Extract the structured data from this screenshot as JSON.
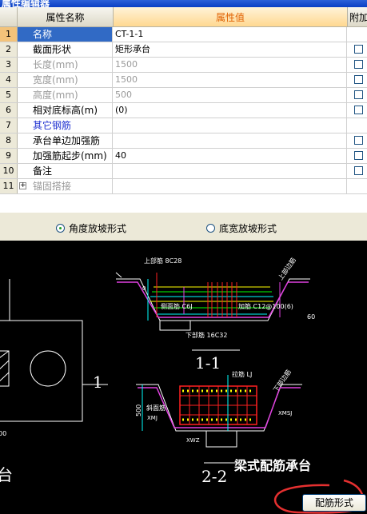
{
  "window": {
    "title": "属性编辑器"
  },
  "table": {
    "headers": {
      "num": "",
      "name": "属性名称",
      "value": "属性值",
      "extra": "附加"
    },
    "rows": [
      {
        "num": "1",
        "name": "名称",
        "value": "CT-1-1",
        "name_style": "normal",
        "value_style": "normal",
        "checkbox": false,
        "selected": true
      },
      {
        "num": "2",
        "name": "截面形状",
        "value": "矩形承台",
        "name_style": "normal",
        "value_style": "normal",
        "checkbox": true
      },
      {
        "num": "3",
        "name": "长度(mm)",
        "value": "1500",
        "name_style": "grey",
        "value_style": "grey",
        "checkbox": true
      },
      {
        "num": "4",
        "name": "宽度(mm)",
        "value": "1500",
        "name_style": "grey",
        "value_style": "grey",
        "checkbox": true
      },
      {
        "num": "5",
        "name": "高度(mm)",
        "value": "500",
        "name_style": "grey",
        "value_style": "grey",
        "checkbox": true
      },
      {
        "num": "6",
        "name": "相对底标高(m)",
        "value": "(0)",
        "name_style": "normal",
        "value_style": "normal",
        "checkbox": true
      },
      {
        "num": "7",
        "name": "其它钢筋",
        "value": "",
        "name_style": "blue",
        "value_style": "normal",
        "checkbox": false
      },
      {
        "num": "8",
        "name": "承台单边加强筋",
        "value": "",
        "name_style": "normal",
        "value_style": "normal",
        "checkbox": true
      },
      {
        "num": "9",
        "name": "加强筋起步(mm)",
        "value": "40",
        "name_style": "normal",
        "value_style": "normal",
        "checkbox": true
      },
      {
        "num": "10",
        "name": "备注",
        "value": "",
        "name_style": "normal",
        "value_style": "normal",
        "checkbox": true
      },
      {
        "num": "11",
        "name": "锚固搭接",
        "value": "",
        "name_style": "grey",
        "value_style": "normal",
        "checkbox": false,
        "expander": "+"
      }
    ]
  },
  "radios": {
    "angle": {
      "label": "角度放坡形式",
      "checked": true
    },
    "bottom_width": {
      "label": "底宽放坡形式",
      "checked": false
    }
  },
  "drawing": {
    "top_rebar": "上部筋 8C28",
    "side_rebar": "侧面筋 C6J",
    "edge_rebar": "加筋 C12@100(6)",
    "bottom_rebar": "下部筋 16C32",
    "top_right_label": "上部边筋",
    "section_1": "1-1",
    "plan_marker": "1",
    "stirrup": "拉筋 LJ",
    "slope_rebar": "斜面筋",
    "left_mark": "XMJ",
    "right_mark": "XMSJ",
    "bottom_mark": "XWZ",
    "height": "500",
    "side_label": "下部边筋",
    "section_2": "2-2",
    "caption": "梁式配筋承台",
    "footer_char": "台",
    "left_dim": "00",
    "dim_60": "60",
    "dim_0": "0"
  },
  "buttons": {
    "rebar_form": "配筋形式"
  },
  "colors": {
    "selected_row": "#316ac5",
    "header_value": "#e06000",
    "annotation_circle": "#e53030"
  }
}
